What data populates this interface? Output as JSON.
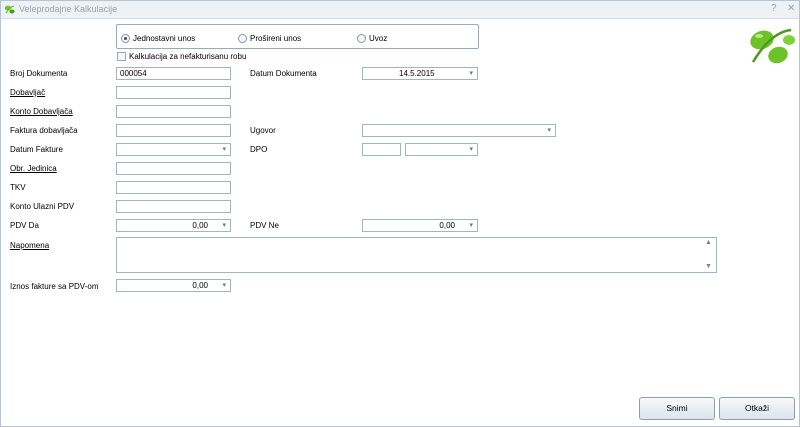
{
  "window": {
    "title": "Veleprodajne Kalkulacije",
    "help_glyph": "?",
    "close_glyph": "✕"
  },
  "entry_mode": {
    "options": [
      {
        "label": "Jednostavni unos",
        "selected": true
      },
      {
        "label": "Prošireni unos",
        "selected": false
      },
      {
        "label": "Uvoz",
        "selected": false
      }
    ]
  },
  "checkbox_nefakturisano": {
    "label": "Kalkulacija za nefakturisanu robu",
    "checked": false
  },
  "form": {
    "broj_dokumenta": {
      "label": "Broj Dokumenta",
      "value": "000054"
    },
    "datum_dokumenta": {
      "label": "Datum Dokumenta",
      "value": "14.5.2015"
    },
    "dobavljac": {
      "label": "Dobavljač",
      "value": ""
    },
    "konto_dobavljaca": {
      "label": "Konto Dobavljača",
      "value": ""
    },
    "faktura_dobavljaca": {
      "label": "Faktura dobavljača",
      "value": ""
    },
    "ugovor": {
      "label": "Ugovor",
      "value": ""
    },
    "datum_fakture": {
      "label": "Datum Fakture",
      "value": ""
    },
    "dpo": {
      "label": "DPO",
      "value": "",
      "unit": ""
    },
    "obr_jedinica": {
      "label": "Obr. Jedinica",
      "value": ""
    },
    "tkv": {
      "label": "TKV",
      "value": ""
    },
    "konto_ulazni_pdv": {
      "label": "Konto Ulazni PDV",
      "value": ""
    },
    "pdv_da": {
      "label": "PDV Da",
      "value": "0,00"
    },
    "pdv_ne": {
      "label": "PDV Ne",
      "value": "0,00"
    },
    "napomena": {
      "label": "Napomena",
      "value": ""
    },
    "iznos_fakture": {
      "label": "Iznos fakture sa PDV-om",
      "value": "0,00"
    }
  },
  "buttons": {
    "save": "Snimi",
    "cancel": "Otkaži"
  },
  "icons": {
    "dropdown": "▾",
    "scroll_up": "▲",
    "scroll_down": "▼"
  },
  "colors": {
    "logo_green": "#6dc22a",
    "border": "#a7b3c3"
  }
}
